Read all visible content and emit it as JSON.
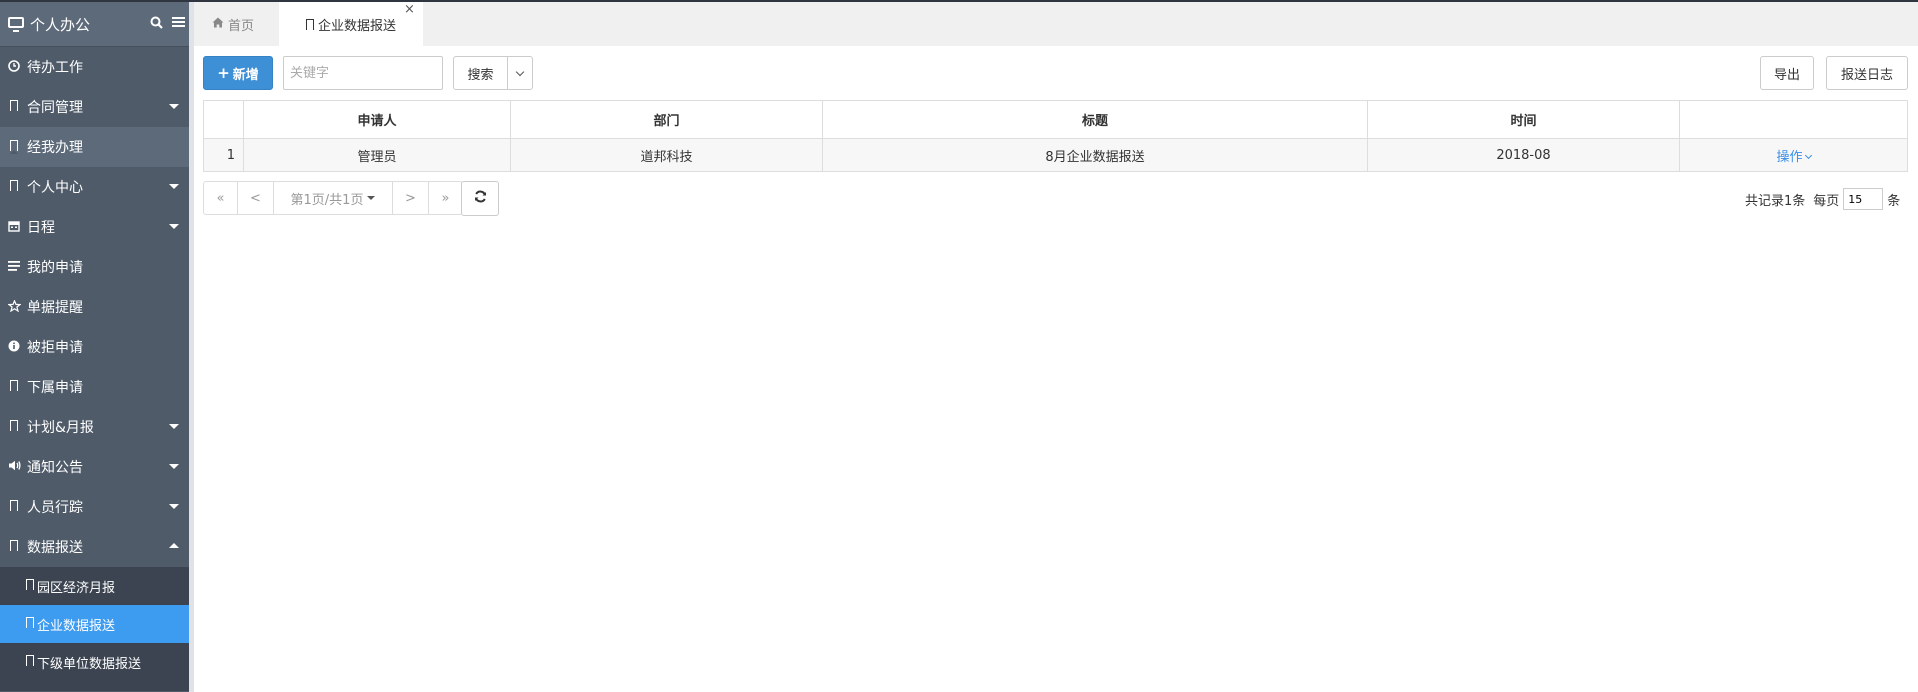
{
  "app": {
    "title": "个人办公"
  },
  "sidebar": {
    "items": [
      {
        "label": "待办工作",
        "icon": "clock-icon"
      },
      {
        "label": "合同管理",
        "icon": "bookmark-icon",
        "caret": "down"
      },
      {
        "label": "经我办理",
        "icon": "bookmark-icon",
        "active": true
      },
      {
        "label": "个人中心",
        "icon": "bookmark-icon",
        "caret": "down"
      },
      {
        "label": "日程",
        "icon": "calendar-icon",
        "caret": "down"
      },
      {
        "label": "我的申请",
        "icon": "list-icon"
      },
      {
        "label": "单据提醒",
        "icon": "star-icon"
      },
      {
        "label": "被拒申请",
        "icon": "info-icon"
      },
      {
        "label": "下属申请",
        "icon": "bookmark-icon"
      },
      {
        "label": "计划&月报",
        "icon": "bookmark-icon",
        "caret": "down"
      },
      {
        "label": "通知公告",
        "icon": "volume-icon",
        "caret": "down"
      },
      {
        "label": "人员行踪",
        "icon": "bookmark-icon",
        "caret": "down"
      },
      {
        "label": "数据报送",
        "icon": "bookmark-icon",
        "caret": "up"
      }
    ],
    "subitems": [
      {
        "label": "园区经济月报"
      },
      {
        "label": "企业数据报送",
        "active": true
      },
      {
        "label": "下级单位数据报送"
      }
    ]
  },
  "tabs": {
    "home": "首页",
    "current": "企业数据报送",
    "close": "×"
  },
  "toolbar": {
    "add_label": "新增",
    "add_plus": "+",
    "search_placeholder": "关键字",
    "search_label": "搜索",
    "export_label": "导出",
    "log_label": "报送日志"
  },
  "table": {
    "headers": [
      "",
      "申请人",
      "部门",
      "标题",
      "时间",
      ""
    ],
    "rows": [
      {
        "num": "1",
        "applicant": "管理员",
        "dept": "道邦科技",
        "title": "8月企业数据报送",
        "time": "2018-08",
        "action": "操作"
      }
    ]
  },
  "pager": {
    "first": "«",
    "prev": "<",
    "page_label": "第1页/共1页",
    "next": ">",
    "last": "»",
    "total_label": "共记录1条",
    "per_page_label": "每页",
    "per_page_value": "15",
    "unit": "条"
  },
  "colors": {
    "sidebar_bg": "#4f5b69",
    "sidebar_active_sub": "#3d9bf0",
    "primary": "#3d8fd6"
  }
}
